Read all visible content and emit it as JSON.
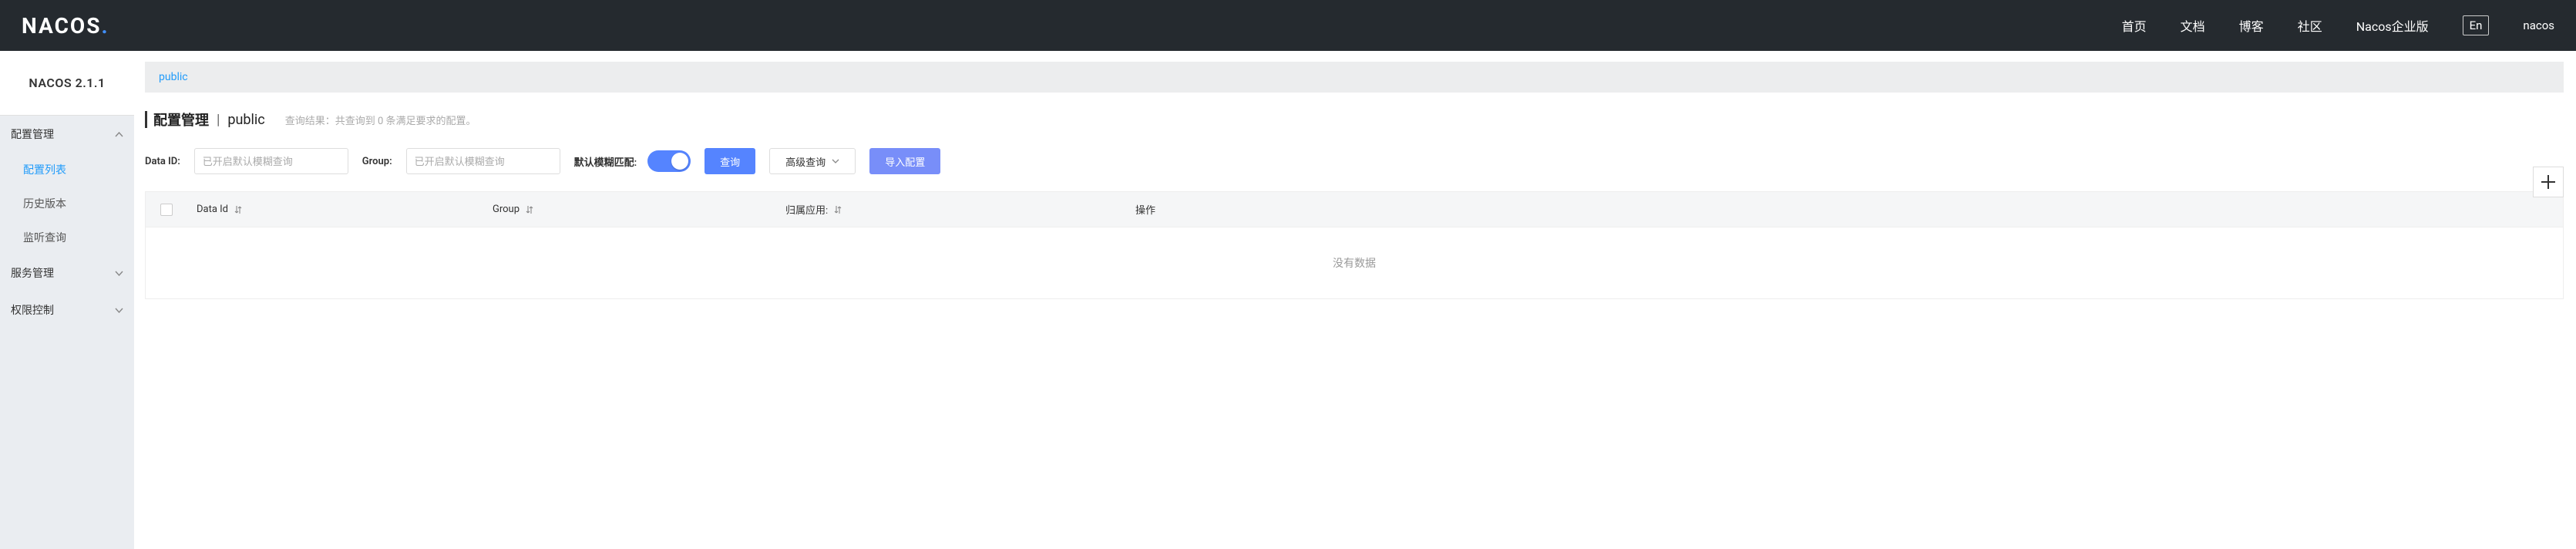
{
  "header": {
    "logo_main": "NACOS",
    "nav": {
      "home": "首页",
      "docs": "文档",
      "blog": "博客",
      "community": "社区",
      "enterprise": "Nacos企业版"
    },
    "lang": "En",
    "user": "nacos"
  },
  "sidebar": {
    "version": "NACOS 2.1.1",
    "groups": {
      "config_mgmt": {
        "label": "配置管理",
        "items": {
          "list": "配置列表",
          "history": "历史版本",
          "listen": "监听查询"
        }
      },
      "service_mgmt": {
        "label": "服务管理"
      },
      "auth": {
        "label": "权限控制"
      }
    }
  },
  "main": {
    "namespace": "public",
    "title": "配置管理",
    "title_namespace": "public",
    "result_prefix": "查询结果：共查询到 ",
    "result_count": "0",
    "result_suffix": " 条满足要求的配置。",
    "search": {
      "dataid_label": "Data ID:",
      "dataid_placeholder": "已开启默认模糊查询",
      "group_label": "Group:",
      "group_placeholder": "已开启默认模糊查询",
      "fuzzy_label": "默认模糊匹配:",
      "query_btn": "查询",
      "advanced_btn": "高级查询",
      "import_btn": "导入配置"
    },
    "table": {
      "cols": {
        "dataid": "Data Id",
        "group": "Group",
        "app": "归属应用:",
        "op": "操作"
      },
      "empty": "没有数据"
    }
  }
}
